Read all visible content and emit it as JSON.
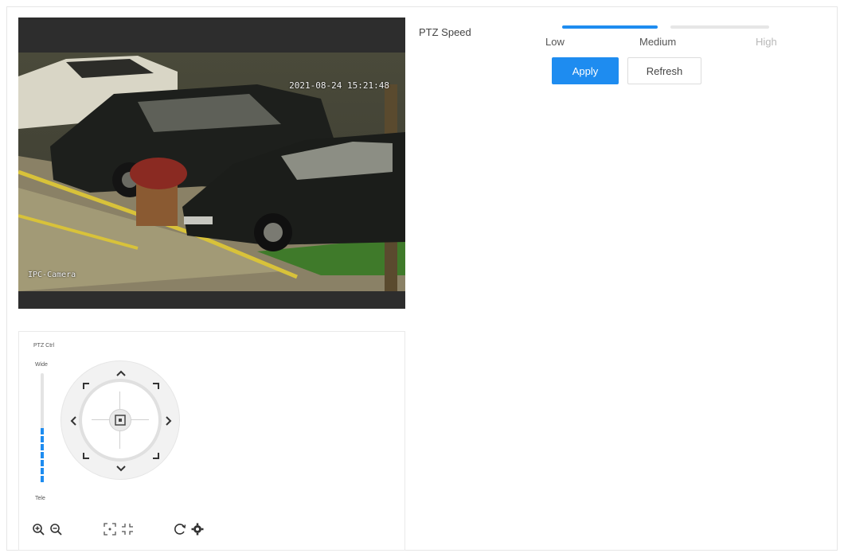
{
  "video": {
    "osd_time": "2021-08-24 15:21:48",
    "osd_name": "IPC-Camera"
  },
  "ptz": {
    "title": "PTZ Ctrl",
    "zoom_top": "Wide",
    "zoom_bottom": "Tele",
    "zoom_level": 0.5,
    "icons": [
      "zoom-in-icon",
      "zoom-out-icon",
      "focus-near-icon",
      "focus-far-icon",
      "iris-icon",
      "settings-icon"
    ]
  },
  "config": {
    "speed_label": "PTZ Speed",
    "speed_value": "Medium",
    "ticks": {
      "low": "Low",
      "medium": "Medium",
      "high": "High"
    },
    "apply_label": "Apply",
    "refresh_label": "Refresh"
  },
  "colors": {
    "accent": "#1e8cf0",
    "video_bg": "#2d2d2d"
  }
}
